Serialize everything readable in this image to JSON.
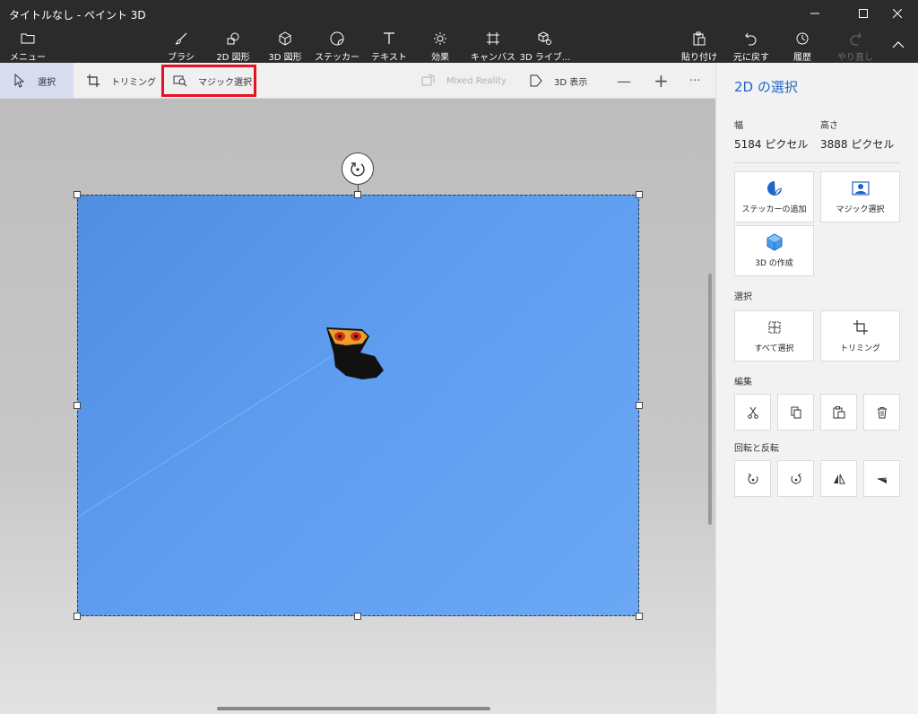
{
  "window": {
    "title": "タイトルなし - ペイント 3D"
  },
  "toolbar": {
    "menu_label": "メニュー",
    "tools": [
      {
        "label": "ブラシ",
        "icon": "brush-icon"
      },
      {
        "label": "2D 図形",
        "icon": "2d-shapes-icon"
      },
      {
        "label": "3D 図形",
        "icon": "3d-shapes-icon"
      },
      {
        "label": "ステッカー",
        "icon": "sticker-icon"
      },
      {
        "label": "テキスト",
        "icon": "text-icon"
      },
      {
        "label": "効果",
        "icon": "effects-icon"
      },
      {
        "label": "キャンバス",
        "icon": "canvas-icon"
      },
      {
        "label": "3D ライブ...",
        "icon": "3d-library-icon"
      }
    ],
    "paste_label": "貼り付け",
    "undo_label": "元に戻す",
    "history_label": "履歴",
    "redo_label": "やり直し"
  },
  "subbar": {
    "select_label": "選択",
    "crop_label": "トリミング",
    "magic_select_label": "マジック選択",
    "mixed_reality_label": "Mixed Reality",
    "view_3d_label": "3D 表示",
    "zoom_out_symbol": "—",
    "zoom_in_symbol": "+",
    "more_symbol": "···"
  },
  "panel": {
    "title": "2D の選択",
    "width_label": "幅",
    "width_value": "5184 ピクセル",
    "height_label": "高さ",
    "height_value": "3888 ピクセル",
    "add_sticker_label": "ステッカーの追加",
    "magic_select_label": "マジック選択",
    "make_3d_label": "3D の作成",
    "select_section": "選択",
    "select_all_label": "すべて選択",
    "crop_label": "トリミング",
    "edit_section": "編集",
    "rotate_section": "回転と反転"
  },
  "colors": {
    "accent": "#1e66c8",
    "highlight": "#e81123",
    "sky": "#5f9ef0"
  }
}
